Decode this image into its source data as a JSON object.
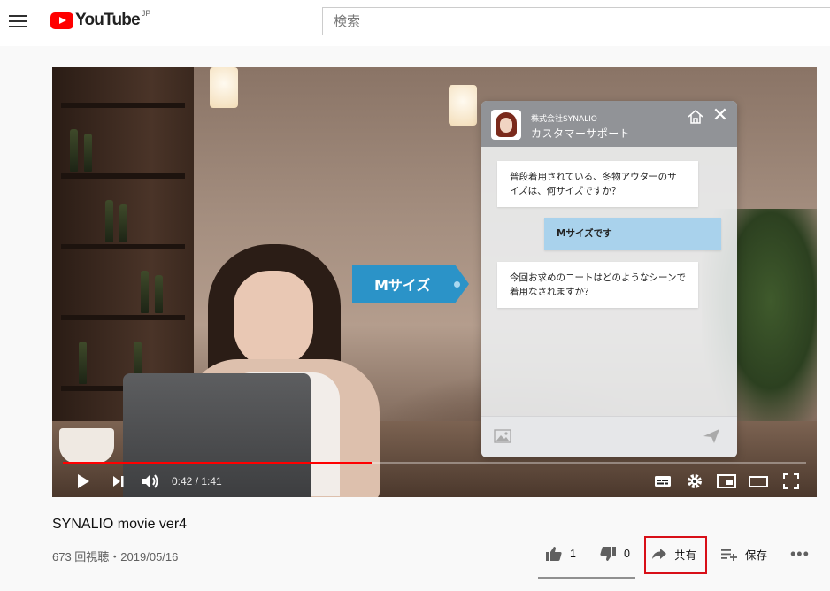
{
  "header": {
    "logo_text": "YouTube",
    "logo_region": "JP",
    "search_placeholder": "検索"
  },
  "chat_widget": {
    "company": "株式会社SYNALIO",
    "title": "カスタマーサポート",
    "messages": [
      {
        "role": "bot",
        "text": "普段着用されている、冬物アウターのサイズは、何サイズですか？"
      },
      {
        "role": "user",
        "text": "Mサイズです"
      },
      {
        "role": "bot",
        "text": "今回お求めのコートはどのようなシーンで着用なされますか？"
      }
    ]
  },
  "callout": {
    "text": "Mサイズ"
  },
  "player": {
    "current_time": "0:42",
    "duration": "1:41",
    "time_display": "0:42 / 1:41",
    "progress_fraction": 0.415
  },
  "video": {
    "title": "SYNALIO movie ver4",
    "meta": "673 回視聴・2019/05/16"
  },
  "actions": {
    "likes": "1",
    "dislikes": "0",
    "share_label": "共有",
    "save_label": "保存",
    "more_label": "•••"
  },
  "colors": {
    "accent": "#ff0000",
    "highlight_box": "#d80f18",
    "tag": "#2b93c8",
    "user_bubble": "#a9d2ec"
  }
}
